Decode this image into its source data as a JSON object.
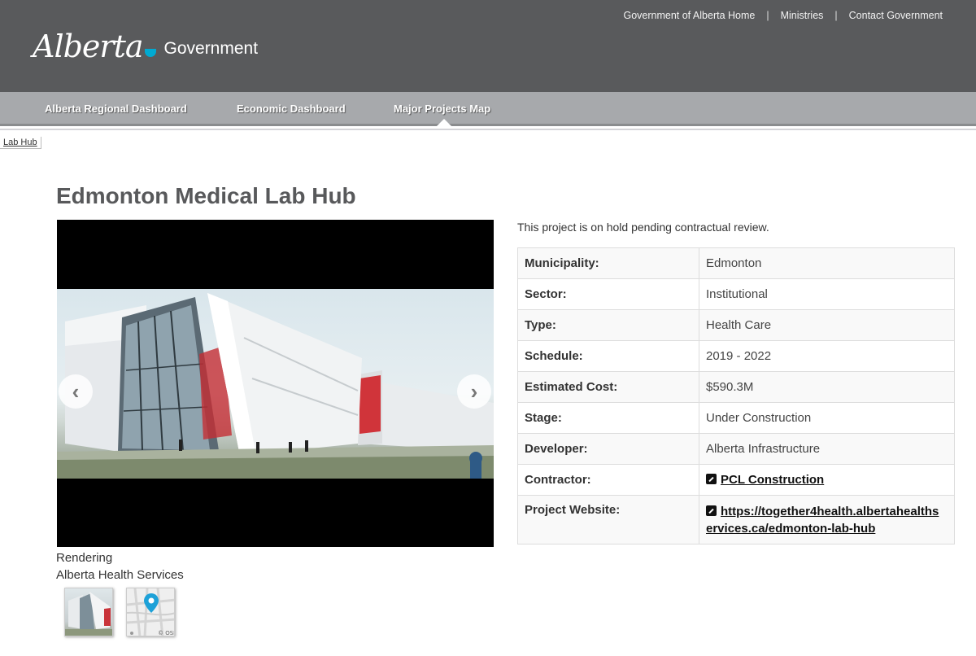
{
  "utility": {
    "home": "Government of Alberta Home",
    "sep": "|",
    "ministries": "Ministries",
    "contact": "Contact Government"
  },
  "logo": {
    "script": "Alberta",
    "gov": "Government",
    "brand_color": "#00aad2"
  },
  "nav": {
    "items": [
      {
        "label": "Alberta Regional Dashboard"
      },
      {
        "label": "Economic Dashboard"
      },
      {
        "label": "Major Projects Map"
      }
    ]
  },
  "breadcrumb": {
    "label": "Lab Hub"
  },
  "page": {
    "title": "Edmonton Medical Lab Hub"
  },
  "carousel": {
    "prev_icon": "‹",
    "next_icon": "›"
  },
  "caption": {
    "line1": "Rendering",
    "line2": "Alberta Health Services"
  },
  "thumbs": {
    "map_attribution": "© OSM"
  },
  "status": "This project is on hold pending contractual review.",
  "details": [
    {
      "key": "Municipality:",
      "value": "Edmonton"
    },
    {
      "key": "Sector:",
      "value": "Institutional"
    },
    {
      "key": "Type:",
      "value": "Health Care"
    },
    {
      "key": "Schedule:",
      "value": "2019 - 2022"
    },
    {
      "key": "Estimated Cost:",
      "value": "$590.3M"
    },
    {
      "key": "Stage:",
      "value": "Under Construction"
    },
    {
      "key": "Developer:",
      "value": "Alberta Infrastructure"
    },
    {
      "key": "Contractor:",
      "value": "PCL Construction"
    },
    {
      "key": "Project Website:",
      "value": "https://together4health.albertahealthservices.ca/edmonton-lab-hub",
      "line1": "https://together4health.albertahealths",
      "line2": "ervices.ca/edmonton-lab-hub"
    }
  ]
}
